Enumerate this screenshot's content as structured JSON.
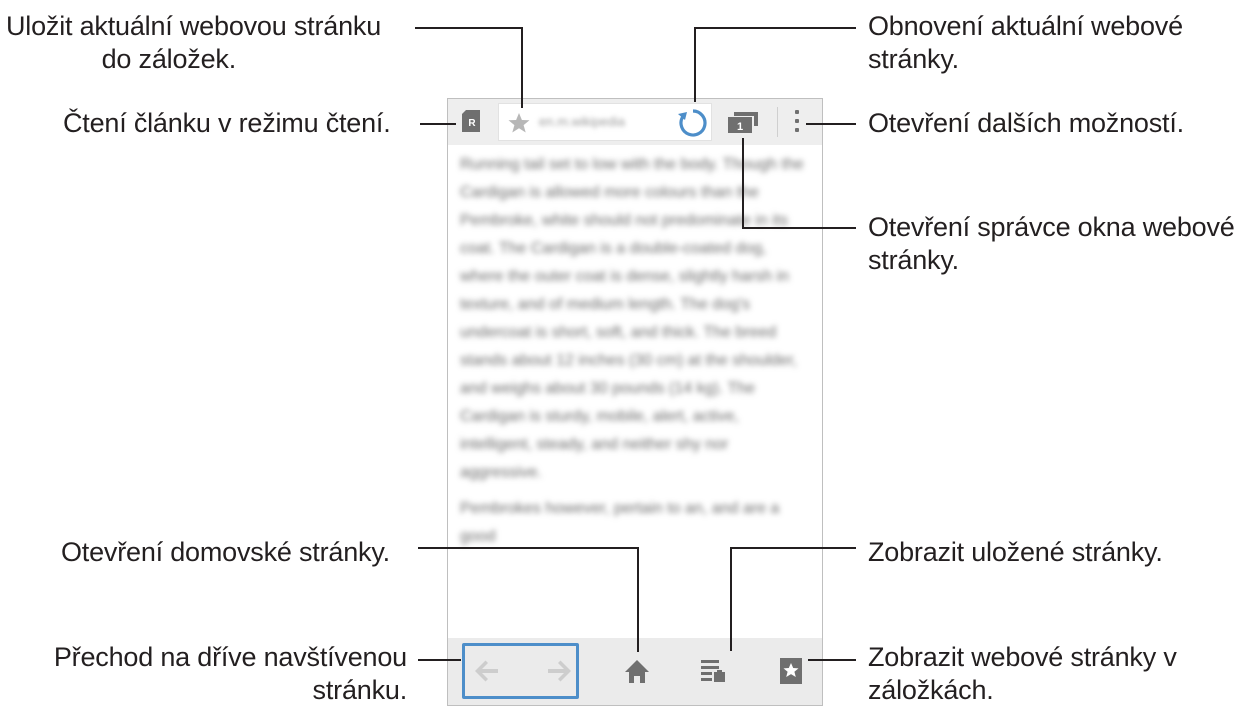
{
  "callouts": {
    "save_bookmark": "Uložit aktuální webovou stránku\ndo záložek.",
    "refresh": "Obnovení aktuální webové\nstránky.",
    "reader_mode": "Čtení článku v režimu čtení.",
    "more_options": "Otevření dalších možností.",
    "window_manager": "Otevření správce okna webové\nstránky.",
    "home": "Otevření domovské stránky.",
    "saved_pages": "Zobrazit uložené stránky.",
    "back_forward": "Přechod na dříve navštívenou\nstránku.",
    "bookmarks": "Zobrazit webové stránky v\nzáložkách."
  },
  "browser": {
    "url": "en.m.wikipedia",
    "article_paragraphs": [
      "Running tail set to low with the body. Though the Cardigan is allowed more colours than the Pembroke, white should not predominate in its coat. The Cardigan is a double-coated dog, where the outer coat is dense, slightly harsh in texture, and of medium length. The dog's undercoat is short, soft, and thick. The breed stands about 12 inches (30 cm) at the shoulder, and weighs about 30 pounds (14 kg). The Cardigan is sturdy, mobile, alert, active, intelligent, steady, and neither shy nor aggressive.",
      "Pembrokes however, pertain to an, and are a good"
    ]
  },
  "colors": {
    "highlight": "#4d8ec9",
    "toolbar": "#eeeeee",
    "icon": "#6f6f6f",
    "leader_line": "#231f20"
  },
  "icons": [
    "reader-mode-icon",
    "star-icon",
    "refresh-icon",
    "tabs-icon",
    "more-vert-icon",
    "back-arrow-icon",
    "forward-arrow-icon",
    "home-icon",
    "saved-pages-icon",
    "bookmarks-icon"
  ]
}
